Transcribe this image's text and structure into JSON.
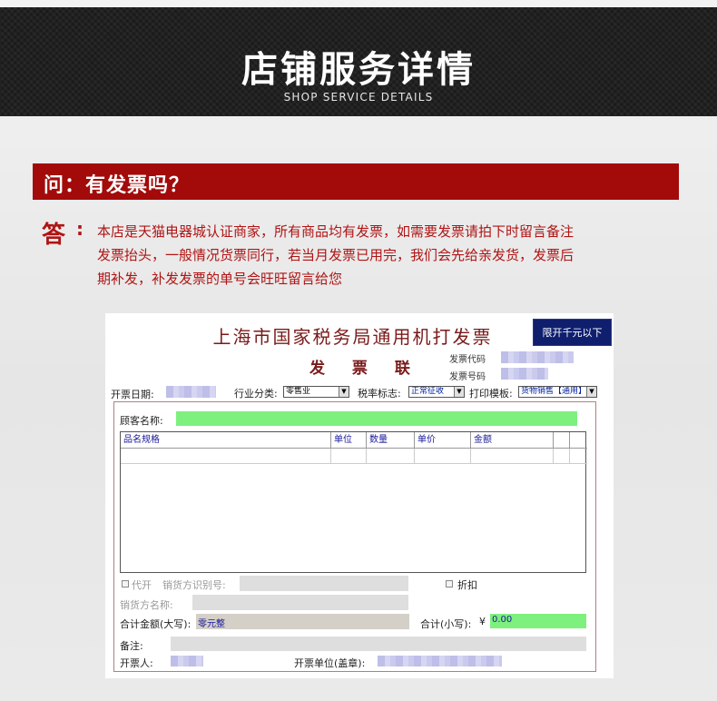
{
  "banner": {
    "title": "店铺服务详情",
    "subtitle": "SHOP SERVICE DETAILS"
  },
  "faq": {
    "question": "问：有发票吗？",
    "answer_label": "答",
    "answer_colon": ":",
    "answer_lines": [
      "本店是天猫电器城认证商家，所有商品均有发票，如需要发票请拍下时留言备注",
      "发票抬头，一般情况货票同行，若当月发票已用完，我们会先给亲发货，发票后",
      "期补发，补发发票的单号会旺旺留言给您"
    ]
  },
  "invoice": {
    "title": "上海市国家税务局通用机打发票",
    "subtitle": "发 票 联",
    "limit_button": "限开千元以下",
    "invoice_code_label": "发票代码",
    "invoice_number_label": "发票号码",
    "issue_date_label": "开票日期:",
    "industry_label": "行业分类:",
    "industry_value": "零售业",
    "tax_flag_label": "税率标志:",
    "tax_flag_value": "正常征收",
    "template_label": "打印模板:",
    "template_value": "货物销售【通用】",
    "customer_label": "顾客名称:",
    "table_columns": [
      "品名规格",
      "单位",
      "数量",
      "单价",
      "金额"
    ],
    "agent_label": "代开",
    "seller_id_label": "销货方识别号:",
    "discount_label": "折扣",
    "seller_name_label": "销货方名称:",
    "total_upper_label": "合计金额(大写):",
    "total_upper_value": "零元整",
    "total_lower_label": "合计(小写):",
    "currency_symbol": "¥",
    "total_lower_value": "0.00",
    "remarks_label": "备注:",
    "issuer_label": "开票人:",
    "issuer_unit_label": "开票单位(盖章):"
  },
  "colors": {
    "banner_bg": "#1b1b1b",
    "question_bar": "#a30a0a",
    "answer_text": "#b01414",
    "invoice_title": "#7a1a1a",
    "limit_button": "#0f1f6e",
    "highlight_green": "#7ef07e"
  }
}
